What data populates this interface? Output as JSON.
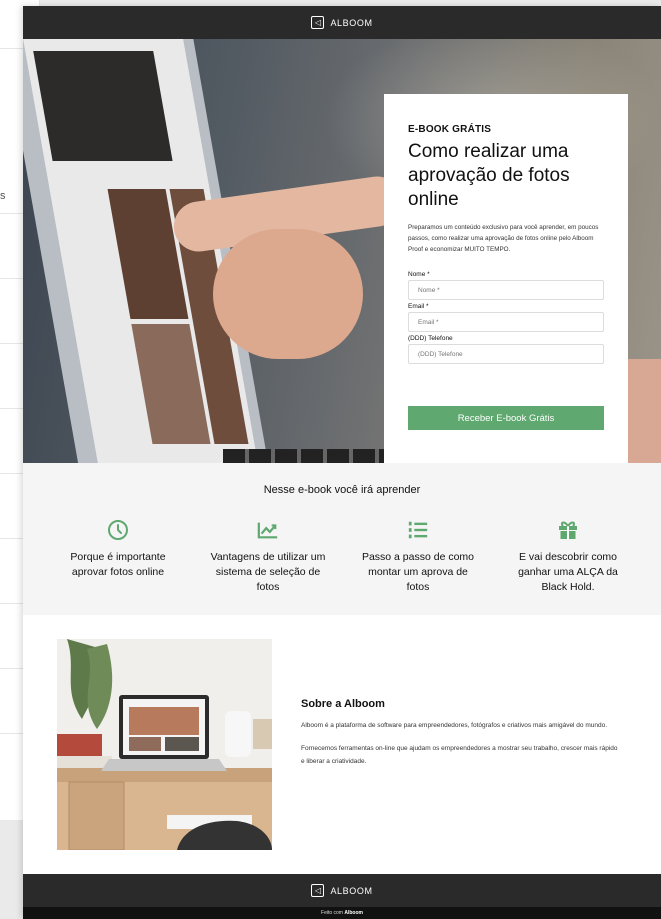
{
  "brand": {
    "name": "ALBOOM",
    "logo_glyph": "◁"
  },
  "hero": {
    "kicker": "E-BOOK GRÁTIS",
    "title": "Como realizar uma aprovação de fotos online",
    "description": "Preparamos um conteúdo exclusivo para você aprender, em poucos passos, como realizar uma aprovação de fotos online pelo Alboom Proof e economizar MUITO TEMPO.",
    "form": {
      "name_label": "Nome *",
      "name_placeholder": "Nome *",
      "email_label": "Email *",
      "email_placeholder": "Email *",
      "phone_label": "(DDD) Telefone",
      "phone_placeholder": "(DDD) Telefone",
      "submit_label": "Receber E-book Grátis"
    }
  },
  "learn": {
    "title": "Nesse e-book você irá aprender",
    "items": [
      {
        "icon": "clock-icon",
        "text": "Porque é importante aprovar fotos online"
      },
      {
        "icon": "chart-icon",
        "text": "Vantagens de utilizar um sistema de seleção de fotos"
      },
      {
        "icon": "numbered-list-icon",
        "text": "Passo a passo de como montar um aprova de fotos"
      },
      {
        "icon": "gift-icon",
        "text": "E vai descobrir como ganhar uma ALÇA da Black Hold."
      }
    ]
  },
  "about": {
    "title": "Sobre a Alboom",
    "p1": "Alboom é a plataforma de software para empreendedores, fotógrafos e criativos mais amigável do mundo.",
    "p2": "Fornecemos ferramentas on-line que ajudam os empreendedores a mostrar seu trabalho, crescer mais rápido e liberar a criatividade."
  },
  "footer": {
    "made_with_prefix": "Feito com",
    "made_with_brand": "Alboom"
  },
  "colors": {
    "accent": "#5fa870",
    "dark": "#2a2a2a"
  }
}
